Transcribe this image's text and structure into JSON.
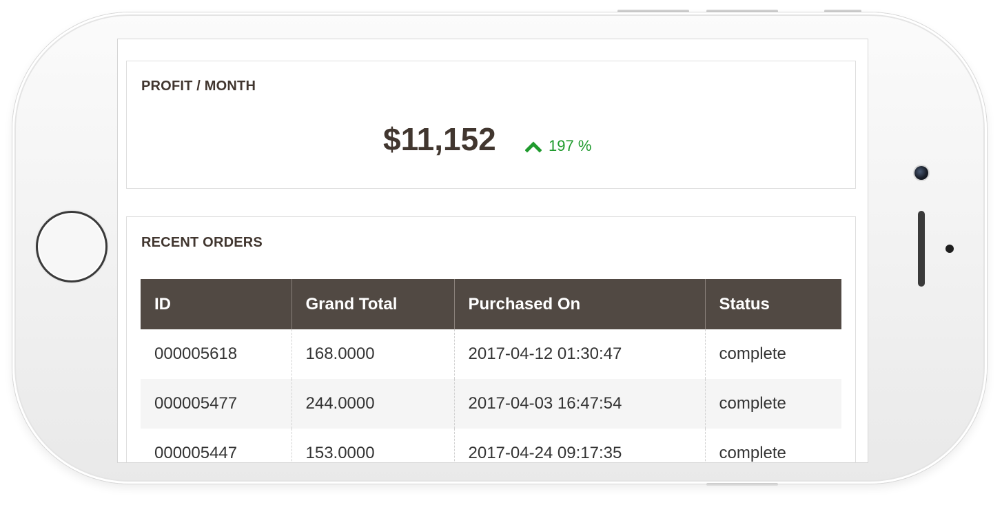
{
  "profit": {
    "title": "PROFIT / MONTH",
    "value": "$11,152",
    "change": "197 %",
    "change_color": "#1f9a2d"
  },
  "orders": {
    "title": "RECENT ORDERS",
    "columns": [
      "ID",
      "Grand Total",
      "Purchased On",
      "Status"
    ],
    "rows": [
      [
        "000005618",
        "168.0000",
        "2017-04-12 01:30:47",
        "complete"
      ],
      [
        "000005477",
        "244.0000",
        "2017-04-03 16:47:54",
        "complete"
      ],
      [
        "000005447",
        "153.0000",
        "2017-04-24 09:17:35",
        "complete"
      ]
    ],
    "header_color": "#514943"
  }
}
